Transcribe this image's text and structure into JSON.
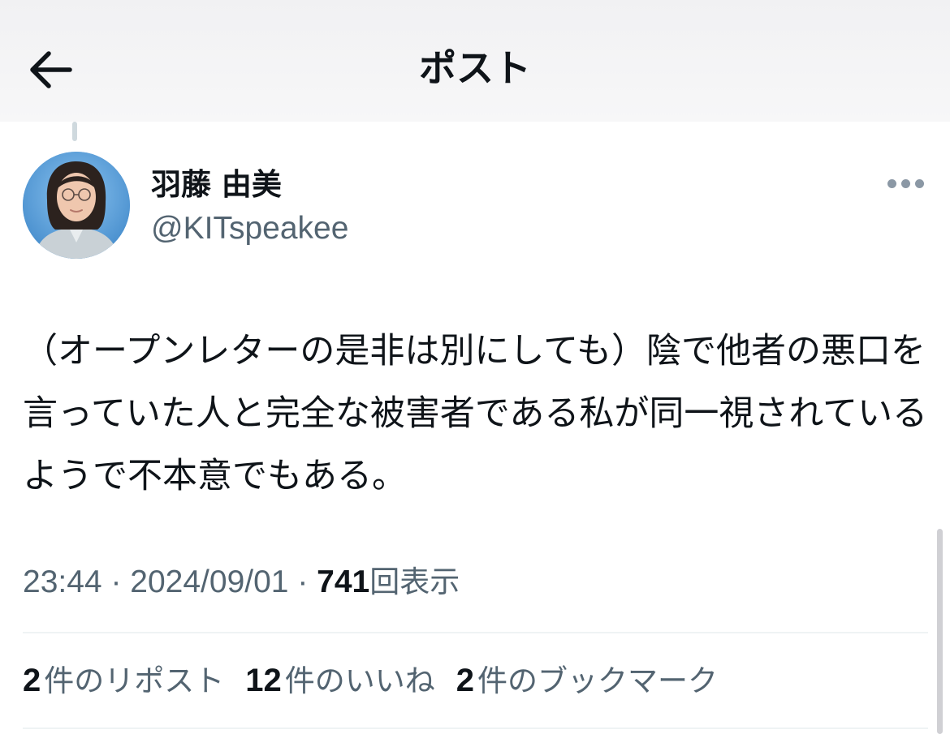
{
  "header": {
    "title": "ポスト"
  },
  "author": {
    "display_name": "羽藤 由美",
    "handle": "@KITspeakee"
  },
  "post": {
    "text": "（オープンレターの是非は別にしても）陰で他者の悪口を言っていた人と完全な被害者である私が同一視されているようで不本意でもある。"
  },
  "meta": {
    "time": "23:44",
    "separator": " · ",
    "date": "2024/09/01",
    "views_count": "741",
    "views_label": "回表示"
  },
  "stats": {
    "reposts_count": "2",
    "reposts_label": "件のリポスト",
    "likes_count": "12",
    "likes_label": "件のいいね",
    "bookmarks_count": "2",
    "bookmarks_label": "件のブックマーク"
  },
  "icons": {
    "back": "arrow-left-icon",
    "more": "more-horizontal-icon"
  },
  "colors": {
    "text_primary": "#0f1419",
    "text_secondary": "#536471",
    "divider": "#eff3f4"
  }
}
